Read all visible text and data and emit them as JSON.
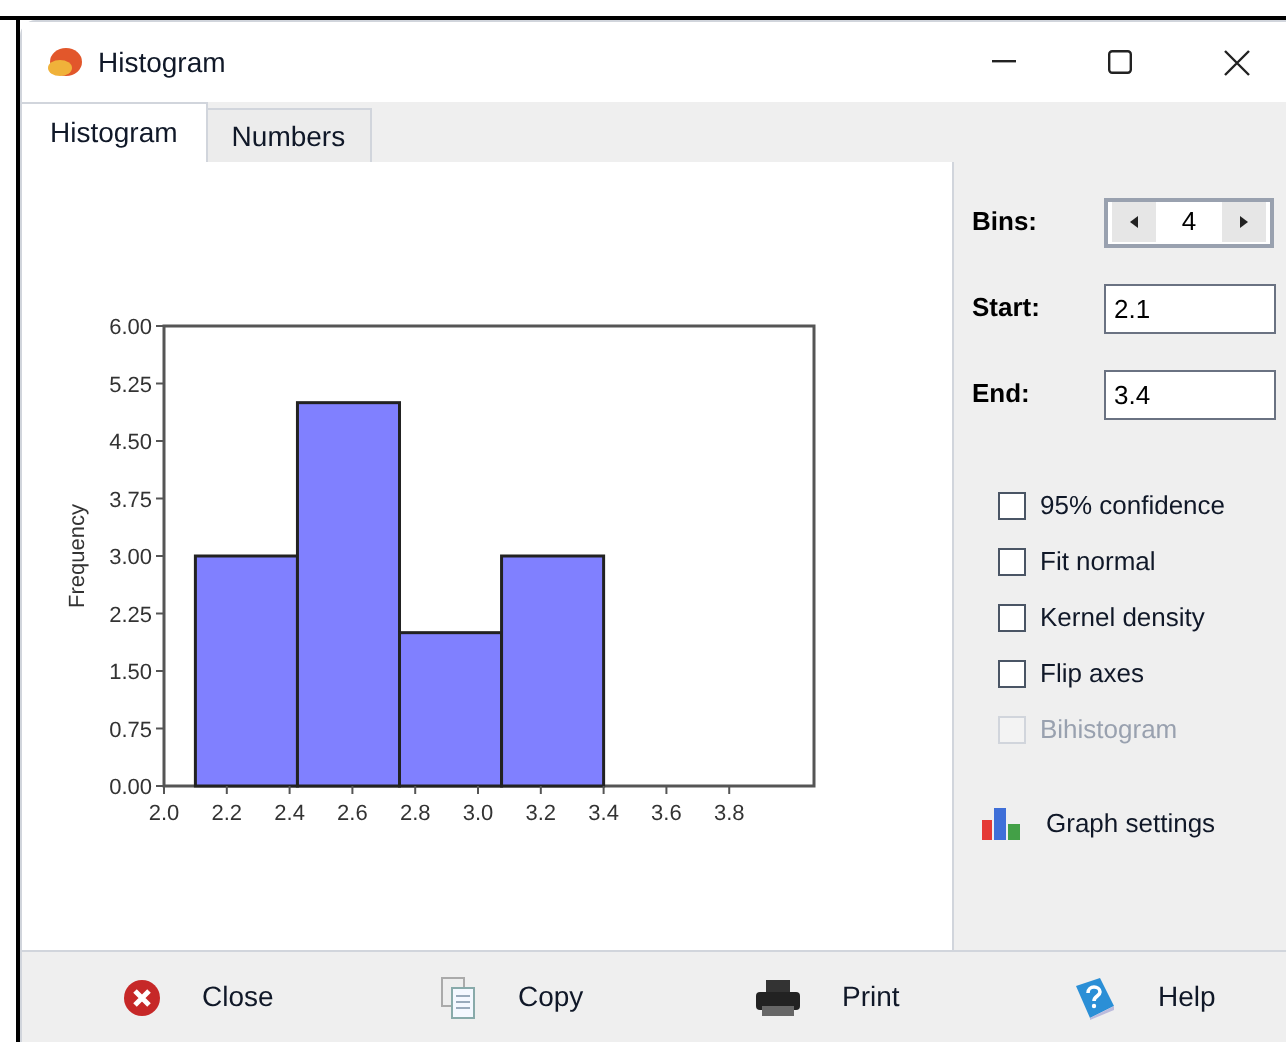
{
  "window": {
    "title": "Histogram"
  },
  "tabs": [
    {
      "label": "Histogram",
      "selected": true
    },
    {
      "label": "Numbers",
      "selected": false
    }
  ],
  "chart": {
    "chart_data": {
      "type": "bar",
      "ylabel": "Frequency",
      "x": [
        2.2625,
        2.5875,
        2.9125,
        3.2375
      ],
      "xlim": [
        2.0,
        4.07
      ],
      "ylim": [
        0,
        6
      ],
      "xticks": [
        {
          "value": 2.0,
          "label": "2.0"
        },
        {
          "value": 2.2,
          "label": "2.2"
        },
        {
          "value": 2.4,
          "label": "2.4"
        },
        {
          "value": 2.6,
          "label": "2.6"
        },
        {
          "value": 2.8,
          "label": "2.8"
        },
        {
          "value": 3.0,
          "label": "3.0"
        },
        {
          "value": 3.2,
          "label": "3.2"
        },
        {
          "value": 3.4,
          "label": "3.4"
        },
        {
          "value": 3.6,
          "label": "3.6"
        },
        {
          "value": 3.8,
          "label": "3.8"
        }
      ],
      "yticks": [
        {
          "value": 0,
          "label": "0.00"
        },
        {
          "value": 0.75,
          "label": "0.75"
        },
        {
          "value": 1.5,
          "label": "1.50"
        },
        {
          "value": 2.25,
          "label": "2.25"
        },
        {
          "value": 3,
          "label": "3.00"
        },
        {
          "value": 3.75,
          "label": "3.75"
        },
        {
          "value": 4.5,
          "label": "4.50"
        },
        {
          "value": 5.25,
          "label": "5.25"
        },
        {
          "value": 6,
          "label": "6.00"
        }
      ],
      "series": [
        {
          "color": "#8080ff",
          "values": [
            3,
            5,
            2,
            3
          ]
        }
      ]
    }
  },
  "settings": {
    "bins": {
      "label": "Bins:",
      "value": "4"
    },
    "start": {
      "label": "Start:",
      "value": "2.1"
    },
    "end": {
      "label": "End:",
      "value": "3.4"
    }
  },
  "options": [
    {
      "label": "95% confidence",
      "checked": false,
      "disabled": false
    },
    {
      "label": "Fit normal",
      "checked": false,
      "disabled": false
    },
    {
      "label": "Kernel density",
      "checked": false,
      "disabled": false
    },
    {
      "label": "Flip axes",
      "checked": false,
      "disabled": false
    },
    {
      "label": "Bihistogram",
      "checked": false,
      "disabled": true
    }
  ],
  "graph_settings": {
    "label": "Graph settings"
  },
  "buttons": [
    {
      "kind": "close",
      "label": "Close"
    },
    {
      "kind": "copy",
      "label": "Copy"
    },
    {
      "kind": "print",
      "label": "Print"
    },
    {
      "kind": "help",
      "label": "Help"
    }
  ]
}
